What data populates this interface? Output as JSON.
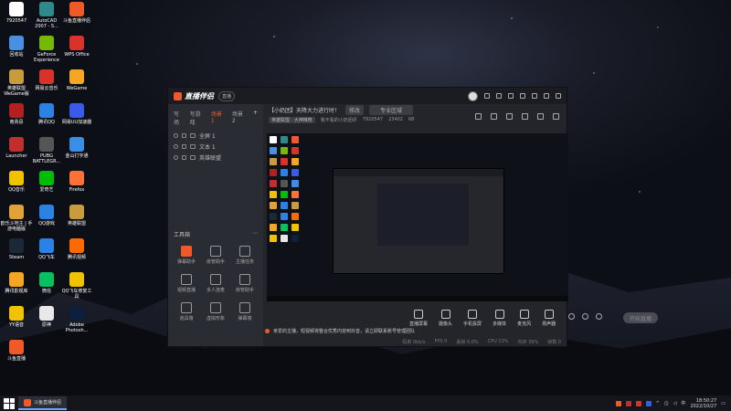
{
  "desktop": {
    "icons": [
      {
        "label": "7920547",
        "color": "#ffffff"
      },
      {
        "label": "AutoCAD 2007 - S...",
        "color": "#2f8a8a"
      },
      {
        "label": "斗鱼直播伴侣",
        "color": "#f05a28"
      },
      {
        "label": "回收站",
        "color": "#4a90e2"
      },
      {
        "label": "GeForce Experience",
        "color": "#76b900"
      },
      {
        "label": "WPS Office",
        "color": "#d9322b"
      },
      {
        "label": "英雄联盟WeGame版",
        "color": "#c89b3c"
      },
      {
        "label": "网易云音乐",
        "color": "#d9322b"
      },
      {
        "label": "WeGame",
        "color": "#f5a623"
      },
      {
        "label": "南贡县",
        "color": "#b32020"
      },
      {
        "label": "腾讯QQ",
        "color": "#2a82e4"
      },
      {
        "label": "网易UU加速器",
        "color": "#3a5ae8"
      },
      {
        "label": "Launcher",
        "color": "#c22e2e"
      },
      {
        "label": "PUBG BATTLEGR...",
        "color": "#555555"
      },
      {
        "label": "金山打字通",
        "color": "#3a8ee6"
      },
      {
        "label": "QQ音乐",
        "color": "#f2c100"
      },
      {
        "label": "爱奇艺",
        "color": "#00be06"
      },
      {
        "label": "Firefox",
        "color": "#ff7139"
      },
      {
        "label": "欧乐斗地主 | 手游电脑版",
        "color": "#e2a23a"
      },
      {
        "label": "QQ游戏",
        "color": "#2a82e4"
      },
      {
        "label": "英雄联盟",
        "color": "#c89b3c"
      },
      {
        "label": "Steam",
        "color": "#1b2838"
      },
      {
        "label": "QQ飞车",
        "color": "#2a82e4"
      },
      {
        "label": "腾讯视频",
        "color": "#ff6a00"
      },
      {
        "label": "腾讯影视库",
        "color": "#f5a623"
      },
      {
        "label": "微信",
        "color": "#07c160"
      },
      {
        "label": "QQ飞车修复工具",
        "color": "#f2c100"
      },
      {
        "label": "YY语音",
        "color": "#f2c100"
      },
      {
        "label": "原神",
        "color": "#e8e8e8"
      },
      {
        "label": "Adobe Photosh...",
        "color": "#0d1f3c"
      },
      {
        "label": "斗鱼直播",
        "color": "#f05a28"
      }
    ]
  },
  "window": {
    "brand": "直播伴侣",
    "badge": "直播",
    "accent": "#f05a28",
    "scene_tabs": [
      "写场",
      "写游戏",
      "场景 1",
      "场景 2"
    ],
    "active_tab_index": 2,
    "sources": [
      "全屏 1",
      "文本 1",
      "英雄联盟"
    ],
    "toolbox_title": "工具箱",
    "tools": [
      {
        "label": "弹幕助手",
        "hot": true
      },
      {
        "label": "房管助手",
        "hot": false
      },
      {
        "label": "主播任务",
        "hot": false
      },
      {
        "label": "视频直播",
        "hot": false
      },
      {
        "label": "多人连麦",
        "hot": false
      },
      {
        "label": "房管助手",
        "hot": false
      },
      {
        "label": "道具墙",
        "hot": false
      },
      {
        "label": "虚拟形象",
        "hot": false
      },
      {
        "label": "弹幕墙",
        "hot": false
      }
    ],
    "room_title": "【小奶团】天降大力进行时！",
    "edit_label": "修改",
    "category_label": "专业区域",
    "info": {
      "tag": "英雄联盟 · 大神推荐",
      "extra": "我不看的小奶团评",
      "room_id": "7920547",
      "hot": "23402",
      "fans": "68"
    },
    "controls": [
      "直播屏幕",
      "摄像头",
      "手机投屏",
      "多媒体",
      "麦克风",
      "扬声器"
    ],
    "go_live": "开始直播",
    "notice": "亲爱的主播，短视频将整合优秀内容到抖音，请立即联系账号管理团队",
    "status": [
      "码率 0kb/s",
      "FPS 0",
      "丢帧 0.0%",
      "CPU 13%",
      "内存 39%",
      "帧数 0"
    ]
  },
  "taskbar": {
    "app_label": "斗鱼直播伴侣",
    "time": "18:50:27",
    "date": "2022/10/27",
    "lang": "中"
  }
}
